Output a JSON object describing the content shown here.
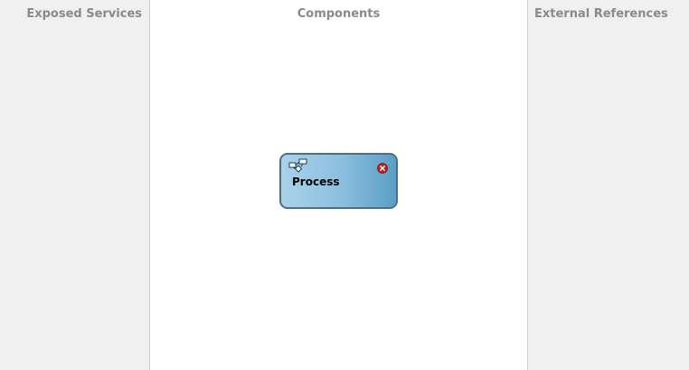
{
  "lanes": {
    "exposed_services": {
      "title": "Exposed Services"
    },
    "components": {
      "title": "Components"
    },
    "external_references": {
      "title": "External References"
    }
  },
  "component": {
    "label": "Process",
    "icon": "process-flow-icon",
    "status_icon": "error-icon",
    "colors": {
      "fill_light": "#a9d2ea",
      "fill_dark": "#5b9fc7",
      "border": "#4d6f86",
      "error": "#c0221a"
    }
  }
}
